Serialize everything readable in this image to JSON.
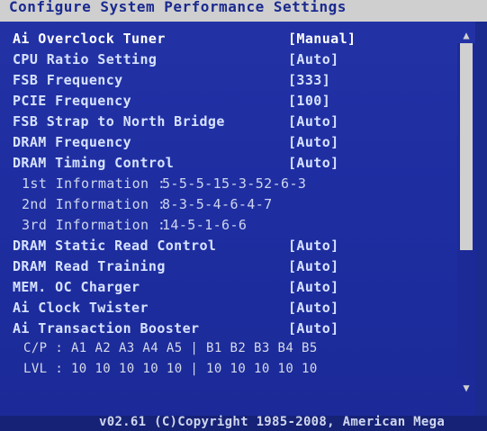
{
  "header": {
    "title": "Configure System Performance Settings"
  },
  "settings": [
    {
      "label": "Ai Overclock Tuner",
      "value": "[Manual]"
    },
    {
      "label": "CPU Ratio Setting",
      "value": "[Auto]"
    },
    {
      "label": "FSB Frequency",
      "value": "[333]"
    },
    {
      "label": "PCIE Frequency",
      "value": "[100]"
    },
    {
      "label": "FSB Strap to North Bridge",
      "value": "[Auto]"
    },
    {
      "label": "DRAM Frequency",
      "value": "[Auto]"
    },
    {
      "label": "DRAM Timing Control",
      "value": "[Auto]"
    }
  ],
  "timing_info": [
    {
      "label": "1st Information :",
      "value": "5-5-5-15-3-52-6-3"
    },
    {
      "label": "2nd Information :",
      "value": "8-3-5-4-6-4-7"
    },
    {
      "label": "3rd Information :",
      "value": "14-5-1-6-6"
    }
  ],
  "settings2": [
    {
      "label": "DRAM Static Read Control",
      "value": "[Auto]"
    },
    {
      "label": "DRAM Read Training",
      "value": "[Auto]"
    },
    {
      "label": "MEM. OC Charger",
      "value": "[Auto]"
    },
    {
      "label": "Ai Clock Twister",
      "value": "[Auto]"
    },
    {
      "label": "Ai Transaction Booster",
      "value": "[Auto]"
    }
  ],
  "cp_table": {
    "cp_row": "C/P : A1 A2 A3 A4 A5 | B1 B2 B3 B4 B5",
    "lvl_row": "LVL : 10 10 10 10 10 | 10 10 10 10 10"
  },
  "footer": {
    "text": "v02.61 (C)Copyright 1985-2008, American Mega"
  },
  "icons": {
    "scroll_up": "scroll-up-icon",
    "scroll_down": "scroll-down-icon"
  },
  "colors": {
    "background": "#1e2ea1",
    "title_bar": "#cfcfcf",
    "text": "#d7e2ff",
    "highlight": "#ffffff"
  }
}
